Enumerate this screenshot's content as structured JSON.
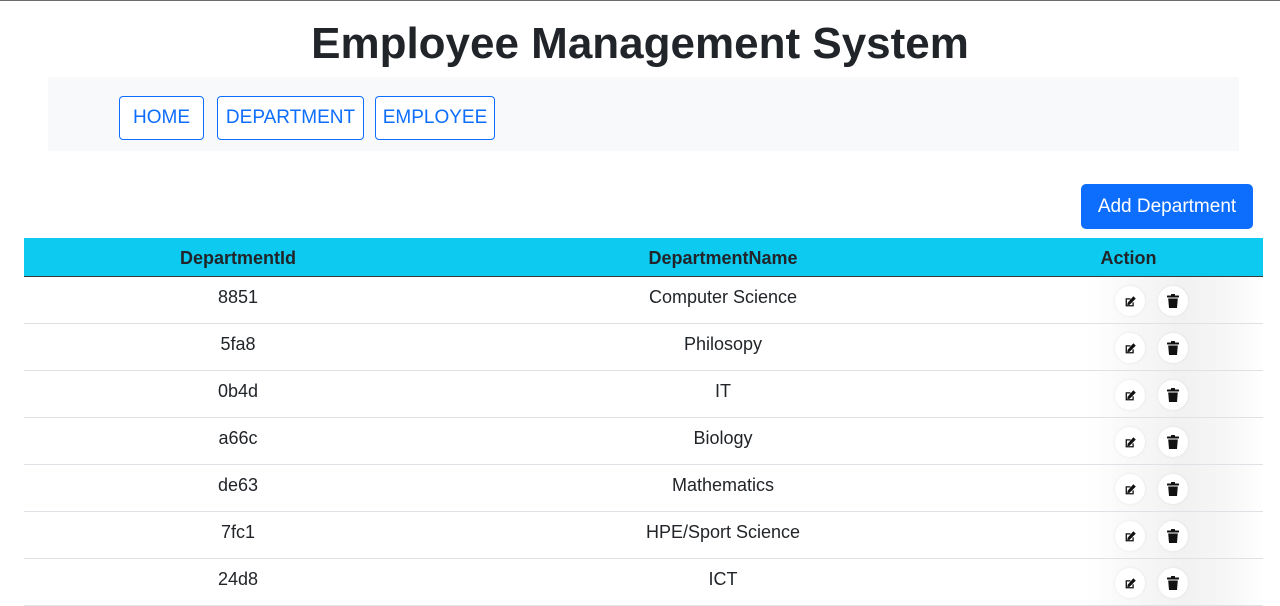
{
  "header": {
    "title": "Employee Management System"
  },
  "nav": {
    "home": "HOME",
    "department": "DEPARTMENT",
    "employee": "EMPLOYEE"
  },
  "toolbar": {
    "add_label": "Add Department"
  },
  "table": {
    "headers": [
      "DepartmentId",
      "DepartmentName",
      "Action"
    ],
    "rows": [
      {
        "id": "8851",
        "name": "Computer Science"
      },
      {
        "id": "5fa8",
        "name": "Philosopy"
      },
      {
        "id": "0b4d",
        "name": "IT"
      },
      {
        "id": "a66c",
        "name": "Biology"
      },
      {
        "id": "de63",
        "name": "Mathematics"
      },
      {
        "id": "7fc1",
        "name": "HPE/Sport Science"
      },
      {
        "id": "24d8",
        "name": "ICT"
      }
    ],
    "row_actions": [
      "edit-icon",
      "trash-icon"
    ]
  },
  "colors": {
    "primary": "#0d6efd",
    "table_header": "#0dcaf0",
    "navbar_bg": "#f8f9fa"
  }
}
